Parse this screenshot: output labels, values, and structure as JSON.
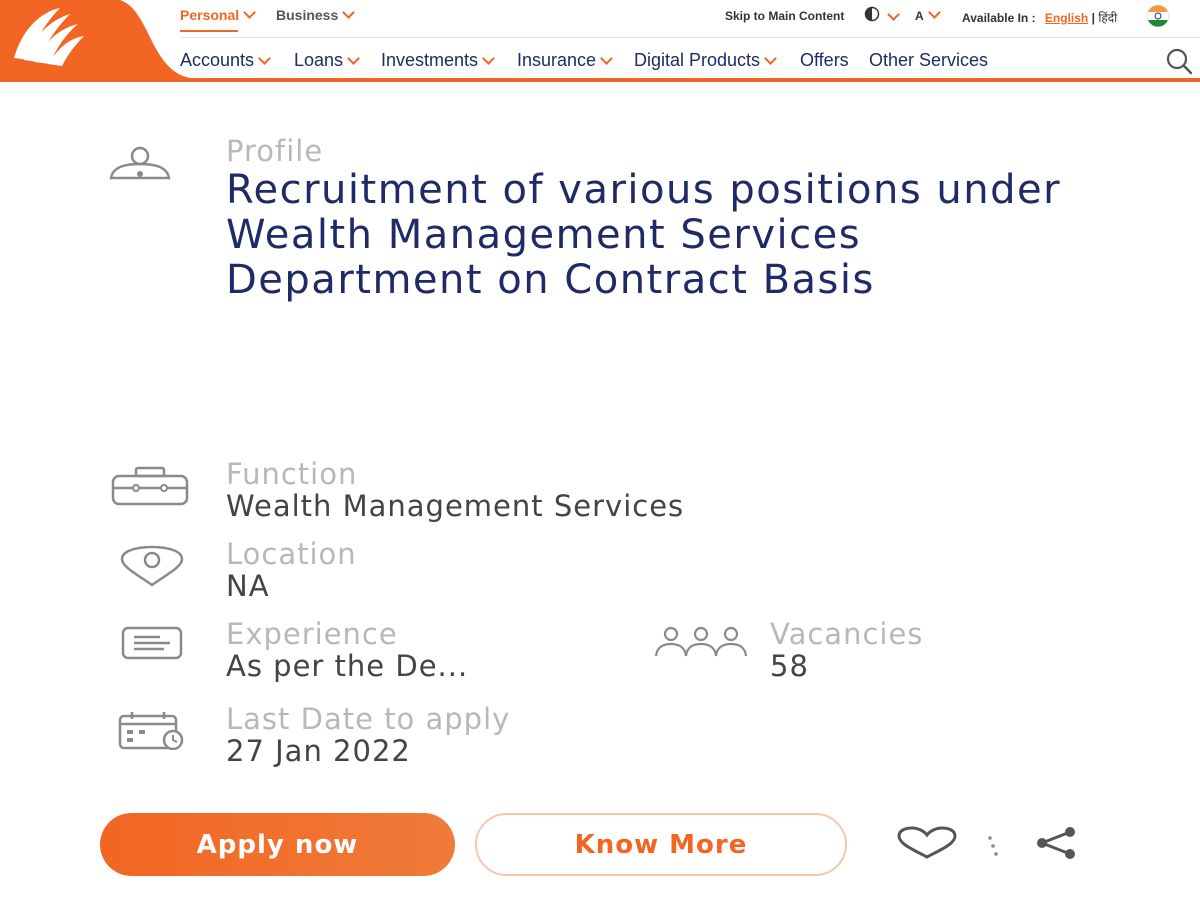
{
  "header": {
    "top_tabs": [
      {
        "label": "Personal",
        "active": true
      },
      {
        "label": "Business",
        "active": false
      }
    ],
    "skip_link": "Skip to Main Content",
    "font_size_label": "A",
    "available_in_label": "Available In :",
    "language_english": "English",
    "language_separator": "|",
    "language_hindi": "हिंदी",
    "nav_items": [
      "Accounts",
      "Loans",
      "Investments",
      "Insurance",
      "Digital Products",
      "Offers",
      "Other Services"
    ],
    "nav_items_with_dropdown": [
      "Accounts",
      "Loans",
      "Investments",
      "Insurance",
      "Digital Products"
    ]
  },
  "job": {
    "profile_label": "Profile",
    "title": "Recruitment of various positions under Wealth Management Services Department on Contract Basis",
    "function_label": "Function",
    "function_value": "Wealth Management Services",
    "location_label": "Location",
    "location_value": "NA",
    "experience_label": "Experience",
    "experience_value": "As per the De...",
    "vacancies_label": "Vacancies",
    "vacancies_value": "58",
    "last_date_label": "Last Date to apply",
    "last_date_value": "27 Jan 2022"
  },
  "actions": {
    "apply_label": "Apply now",
    "know_more_label": "Know More"
  },
  "colors": {
    "brand_orange": "#f26522",
    "navy": "#1f2a66"
  }
}
